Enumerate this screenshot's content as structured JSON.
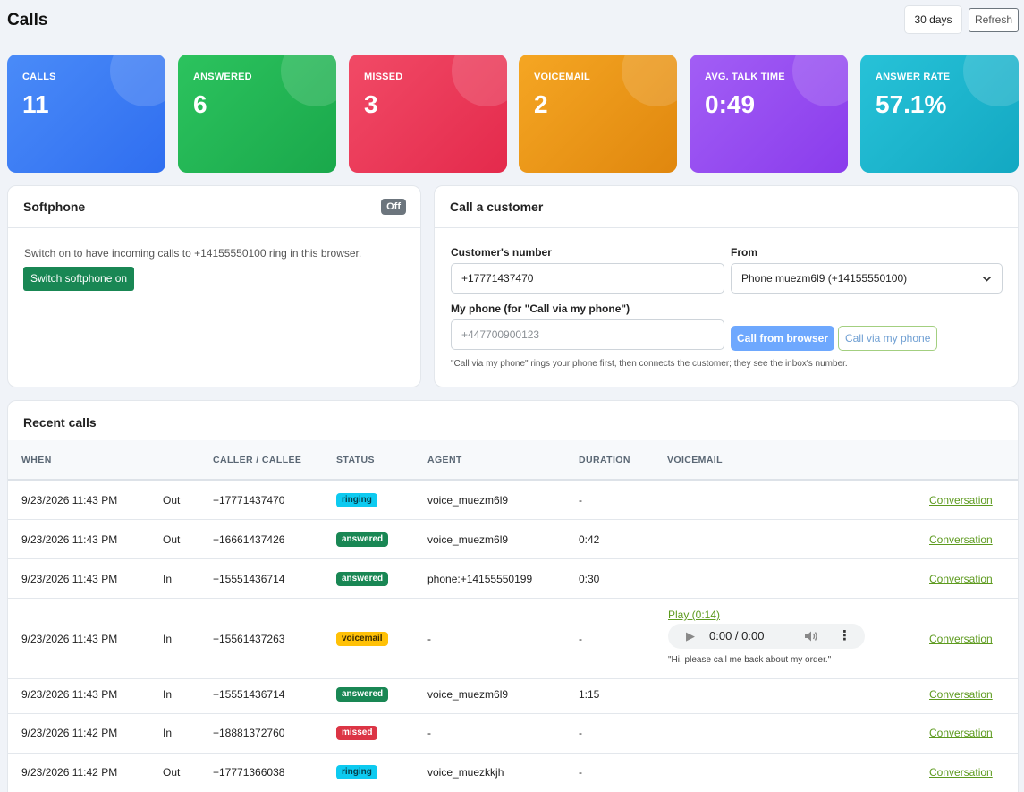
{
  "header": {
    "title": "Calls",
    "range": "30 days",
    "refresh": "Refresh"
  },
  "kpis": [
    {
      "label": "CALLS",
      "value": "11",
      "color": "#3b7bf5"
    },
    {
      "label": "ANSWERED",
      "value": "6",
      "color": "#22b454"
    },
    {
      "label": "MISSED",
      "value": "3",
      "color": "#ee3a5a"
    },
    {
      "label": "VOICEMAIL",
      "value": "2",
      "color": "#f29b18"
    },
    {
      "label": "AVG. TALK TIME",
      "value": "0:49",
      "color": "#9b4cf0"
    },
    {
      "label": "ANSWER RATE",
      "value": "57.1%",
      "color": "#1fb7cf"
    }
  ],
  "softphone": {
    "title": "Softphone",
    "status": "Off",
    "description": "Switch on to have incoming calls to +14155550100 ring in this browser.",
    "button": "Switch softphone on"
  },
  "call_customer": {
    "title": "Call a customer",
    "customer_label": "Customer's number",
    "customer_value": "+17771437470",
    "from_label": "From",
    "from_value": "Phone muezm6l9 (+14155550100)",
    "my_phone_label": "My phone (for \"Call via my phone\")",
    "my_phone_placeholder": "+447700900123",
    "call_browser": "Call from browser",
    "call_phone": "Call via my phone",
    "hint": "\"Call via my phone\" rings your phone first, then connects the customer; they see the inbox's number."
  },
  "recent": {
    "title": "Recent calls",
    "columns": [
      "WHEN",
      "CALLER / CALLEE",
      "STATUS",
      "AGENT",
      "DURATION",
      "VOICEMAIL"
    ],
    "link_label": "Conversation",
    "rows": [
      {
        "when": "9/23/2026 11:43 PM",
        "dir": "Out",
        "number": "+17771437470",
        "status": "ringing",
        "agent": "voice_muezm6l9",
        "duration": "-"
      },
      {
        "when": "9/23/2026 11:43 PM",
        "dir": "Out",
        "number": "+16661437426",
        "status": "answered",
        "agent": "voice_muezm6l9",
        "duration": "0:42"
      },
      {
        "when": "9/23/2026 11:43 PM",
        "dir": "In",
        "number": "+15551436714",
        "status": "answered",
        "agent": "phone:+14155550199",
        "duration": "0:30"
      },
      {
        "when": "9/23/2026 11:43 PM",
        "dir": "In",
        "number": "+15561437263",
        "status": "voicemail",
        "agent": "-",
        "duration": "-",
        "voicemail": {
          "play": "Play (0:14)",
          "time": "0:00 / 0:00",
          "transcript": "\"Hi, please call me back about my order.\""
        }
      },
      {
        "when": "9/23/2026 11:43 PM",
        "dir": "In",
        "number": "+15551436714",
        "status": "answered",
        "agent": "voice_muezm6l9",
        "duration": "1:15"
      },
      {
        "when": "9/23/2026 11:42 PM",
        "dir": "In",
        "number": "+18881372760",
        "status": "missed",
        "agent": "-",
        "duration": "-"
      },
      {
        "when": "9/23/2026 11:42 PM",
        "dir": "Out",
        "number": "+17771366038",
        "status": "ringing",
        "agent": "voice_muezkkjh",
        "duration": "-"
      }
    ]
  }
}
